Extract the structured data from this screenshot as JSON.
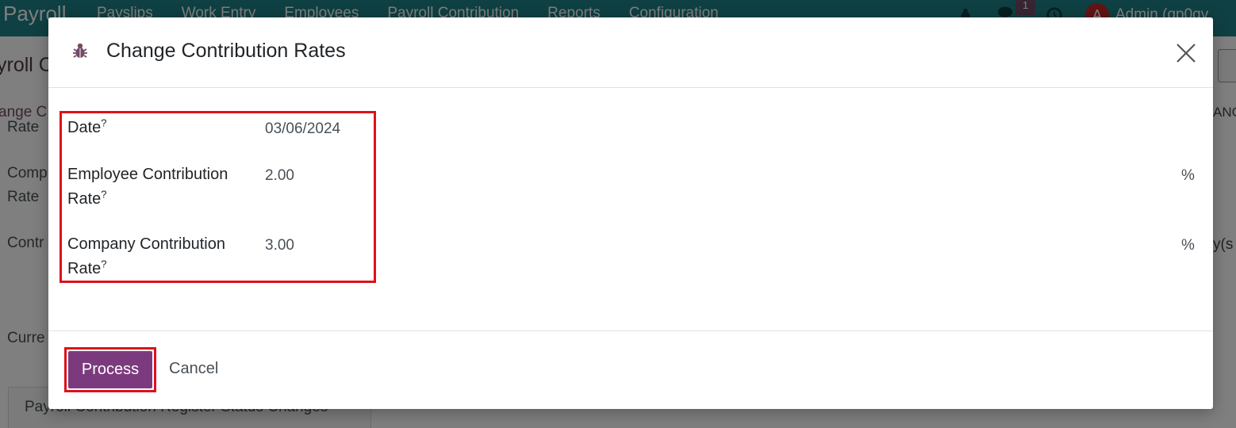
{
  "app": {
    "brand": "Payroll",
    "menu": [
      "Payslips",
      "Work Entry",
      "Employees",
      "Payroll Contribution",
      "Reports",
      "Configuration"
    ],
    "messages_badge": "1",
    "user_initial": "A",
    "user_name": "Admin (qp0qv"
  },
  "background": {
    "title_fragment": "yroll C",
    "subtitle_fragment": "ange C",
    "label_rate_top": "Rate",
    "label_comp_line1": "Comp",
    "label_comp_line2": "Rate",
    "label_contr": "Contr",
    "label_curr": "Curre",
    "tab_label": "Payroll Contribution Register Status Changes",
    "right_anc": "ANC",
    "right_ys": "y(s"
  },
  "dialog": {
    "title": "Change Contribution Rates",
    "fields": [
      {
        "label": "Date",
        "value": "03/06/2024",
        "unit": ""
      },
      {
        "label_line1": "Employee Contribution",
        "label_line2": "Rate",
        "value": "2.00",
        "unit": "%"
      },
      {
        "label_line1": "Company Contribution",
        "label_line2": "Rate",
        "value": "3.00",
        "unit": "%"
      }
    ],
    "help_mark": "?",
    "process_label": "Process",
    "cancel_label": "Cancel"
  },
  "colors": {
    "topbar": "#1f8087",
    "primary": "#7b3a7e",
    "highlight": "#e0101a"
  }
}
